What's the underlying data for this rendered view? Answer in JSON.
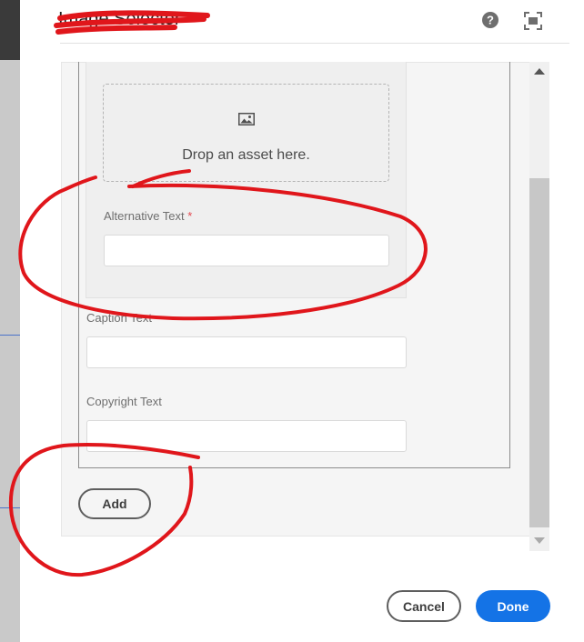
{
  "dialog": {
    "title": "Image Selector"
  },
  "drop_zone": {
    "text": "Drop an asset here.",
    "icon": "image-icon"
  },
  "fields": {
    "alt_text": {
      "label": "Alternative Text",
      "required_marker": "*",
      "value": ""
    },
    "caption_text": {
      "label": "Caption Text",
      "value": ""
    },
    "copyright_text": {
      "label": "Copyright Text",
      "value": ""
    }
  },
  "buttons": {
    "add": "Add",
    "cancel": "Cancel",
    "done": "Done"
  },
  "colors": {
    "accent": "#1473e6",
    "required": "#e34850",
    "annotation_marker": "#e0161b"
  }
}
